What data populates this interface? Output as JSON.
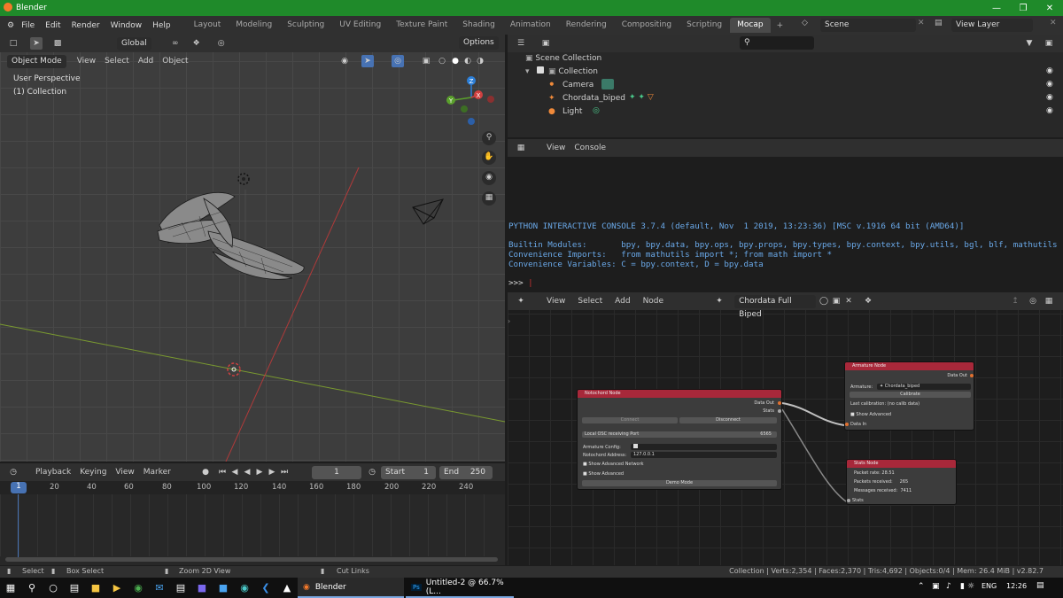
{
  "window": {
    "title": "Blender"
  },
  "menu": [
    "File",
    "Edit",
    "Render",
    "Window",
    "Help"
  ],
  "workspaces": [
    "Layout",
    "Modeling",
    "Sculpting",
    "UV Editing",
    "Texture Paint",
    "Shading",
    "Animation",
    "Rendering",
    "Compositing",
    "Scripting",
    "Mocap"
  ],
  "scene": {
    "name": "Scene",
    "view_layer": "View Layer"
  },
  "viewport": {
    "mode": "Object Mode",
    "menus": [
      "View",
      "Select",
      "Add",
      "Object"
    ],
    "orientation": "Global",
    "options": "Options",
    "info1": "User Perspective",
    "info2": "(1) Collection",
    "gizmo": {
      "x": "X",
      "y": "Y",
      "z": "Z"
    }
  },
  "outliner": {
    "root": "Scene Collection",
    "collection": "Collection",
    "items": [
      "Camera",
      "Chordata_biped",
      "Light"
    ]
  },
  "console": {
    "menus": [
      "View",
      "Console"
    ],
    "line1": "PYTHON INTERACTIVE CONSOLE 3.7.4 (default, Nov  1 2019, 13:23:36) [MSC v.1916 64 bit (AMD64)]",
    "line2": "Builtin Modules:       bpy, bpy.data, bpy.ops, bpy.props, bpy.types, bpy.context, bpy.utils, bgl, blf, mathutils",
    "line3": "Convenience Imports:   from mathutils import *; from math import *",
    "line4": "Convenience Variables: C = bpy.context, D = bpy.data",
    "prompt": ">>> "
  },
  "node_editor": {
    "menus": [
      "View",
      "Select",
      "Add",
      "Node"
    ],
    "tree_name": "Chordata Full Biped"
  },
  "nodes": {
    "notochord": {
      "title": "Notochord Node",
      "data_out": "Data Out",
      "stats": "Stats",
      "connect": "Connect",
      "disconnect": "Disconnect",
      "port_label": "Local OSC receiving Port",
      "port": "6565",
      "armature_config": "Armature Config:",
      "address_label": "Notochord Address:",
      "address": "127.0.0.1",
      "show_adv_net": "Show Advanced Network",
      "show_adv": "Show Advanced",
      "demo": "Demo Mode"
    },
    "armature": {
      "title": "Armature Node",
      "data_out": "Data Out",
      "armature_label": "Armature:",
      "armature": "Chordata_biped",
      "calibrate": "Calibrate",
      "last_cal": "Last calibration: (no calib data)",
      "show_adv": "Show Advanced",
      "data_in": "Data In"
    },
    "stats": {
      "title": "Stats Node",
      "packet_rate_label": "Packet rate:",
      "packet_rate": "28.51",
      "packets_label": "Packets received:",
      "packets": "265",
      "messages_label": "Messages received:",
      "messages": "7411",
      "stats": "Stats"
    }
  },
  "timeline": {
    "menus": [
      "Playback",
      "Keying",
      "View",
      "Marker"
    ],
    "current": "1",
    "start_label": "Start",
    "start": "1",
    "end_label": "End",
    "end": "250",
    "ticks": [
      "1",
      "20",
      "40",
      "60",
      "80",
      "100",
      "120",
      "140",
      "160",
      "180",
      "200",
      "220",
      "240"
    ]
  },
  "statusbar": {
    "select": "Select",
    "box_select": "Box Select",
    "zoom": "Zoom 2D View",
    "cut": "Cut Links",
    "info": "Collection | Verts:2,354 | Faces:2,370 | Tris:4,692 | Objects:0/4 | Mem: 26.4 MiB | v2.82.7"
  },
  "taskbar": {
    "app1": "Blender",
    "app2": "Untitled-2 @ 66.7% (L...",
    "lang": "ENG",
    "time": "12:26"
  }
}
